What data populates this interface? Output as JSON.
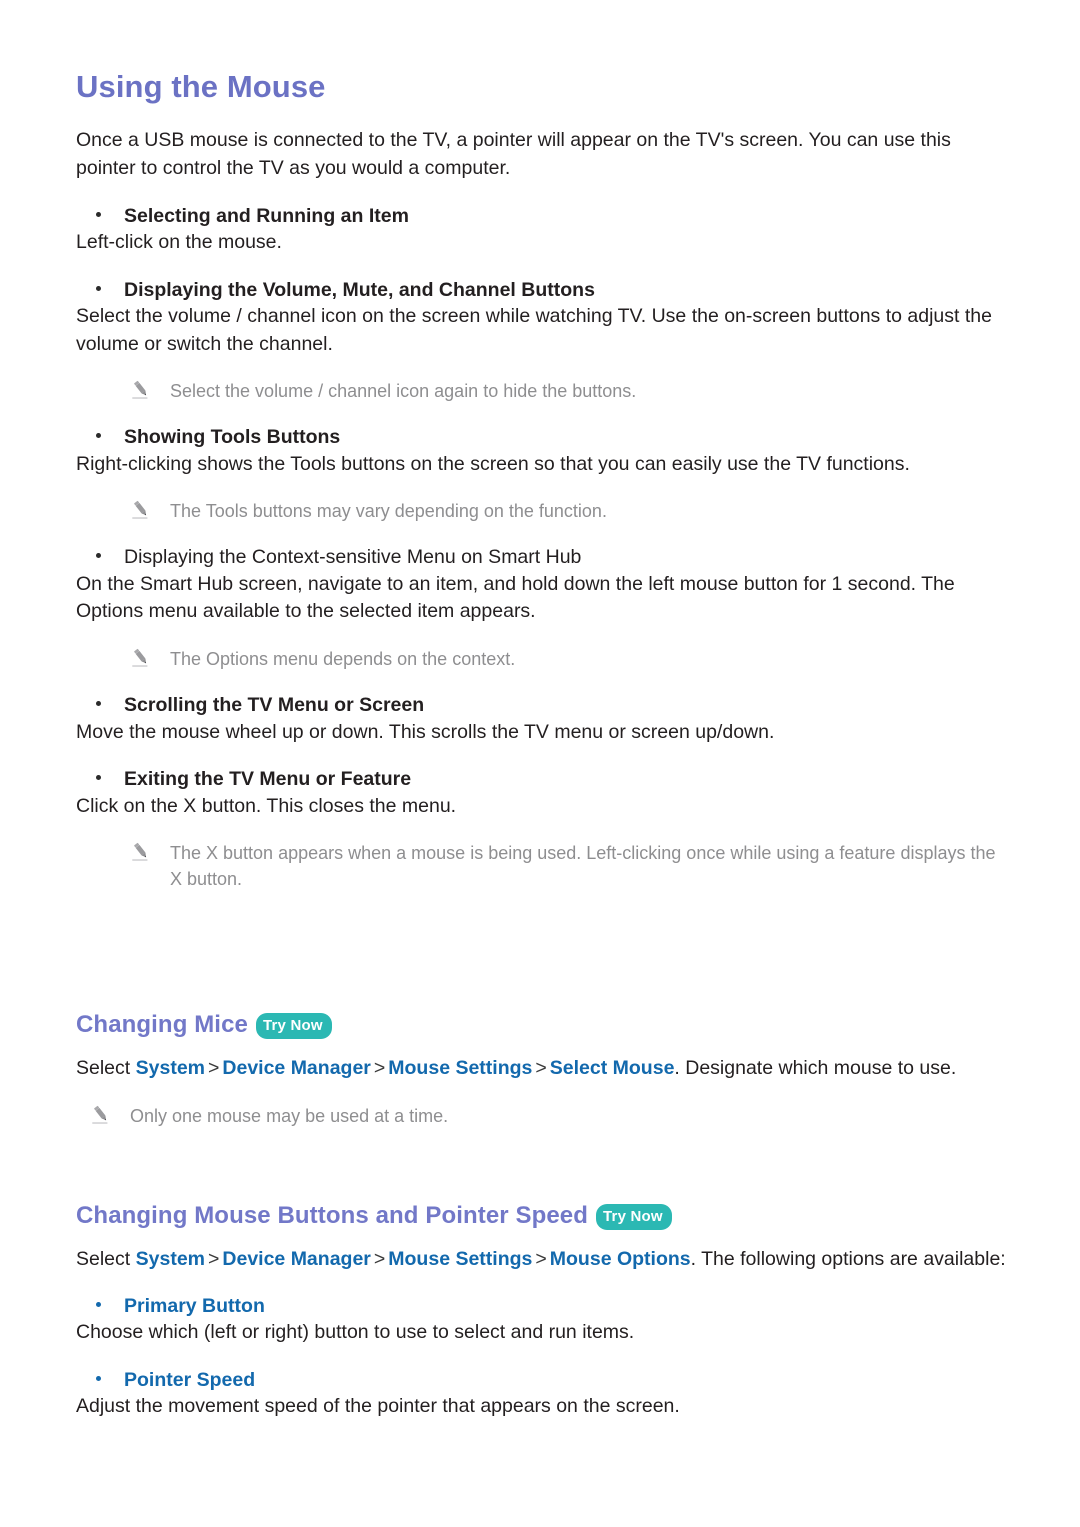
{
  "page": {
    "title": "Using the Mouse",
    "intro": "Once a USB mouse is connected to the TV, a pointer will appear on the TV's screen. You can use this pointer to control the TV as you would a computer."
  },
  "mouse_items": [
    {
      "label": "Selecting and Running an Item",
      "bold": true,
      "body": "Left-click on the mouse.",
      "note": null
    },
    {
      "label": "Displaying the Volume, Mute, and Channel Buttons",
      "bold": true,
      "body": "Select the volume / channel icon on the screen while watching TV. Use the on-screen buttons to adjust the volume or switch the channel.",
      "note": "Select the volume / channel icon again to hide the buttons."
    },
    {
      "label": "Showing Tools Buttons",
      "bold": true,
      "body": "Right-clicking shows the Tools buttons on the screen so that you can easily use the TV functions.",
      "note": "The Tools buttons may vary depending on the function."
    },
    {
      "label": "Displaying the Context-sensitive Menu on Smart Hub",
      "bold": false,
      "body": "On the Smart Hub screen, navigate to an item, and hold down the left mouse button for 1 second. The Options menu available to the selected item appears.",
      "note": "The Options menu depends on the context."
    },
    {
      "label": "Scrolling the TV Menu or Screen",
      "bold": true,
      "body": "Move the mouse wheel up or down. This scrolls the TV menu or screen up/down.",
      "note": null
    },
    {
      "label": "Exiting the TV Menu or Feature",
      "bold": true,
      "body": "Click on the X button. This closes the menu.",
      "note": "The X button appears when a mouse is being used. Left-clicking once while using a feature displays the X button."
    }
  ],
  "changing_mice": {
    "heading": "Changing Mice",
    "try_now": "Try Now",
    "path_prefix": "Select ",
    "path": [
      "System",
      "Device Manager",
      "Mouse Settings",
      "Select Mouse"
    ],
    "separator": ">",
    "path_suffix": ". Designate which mouse to use.",
    "note": "Only one mouse may be used at a time."
  },
  "changing_buttons": {
    "heading": "Changing Mouse Buttons and Pointer Speed",
    "try_now": "Try Now",
    "path_prefix": "Select ",
    "path": [
      "System",
      "Device Manager",
      "Mouse Settings",
      "Mouse Options"
    ],
    "separator": ">",
    "path_suffix": ". The following options are available:",
    "options": [
      {
        "label": "Primary Button",
        "body": "Choose which (left or right) button to use to select and run items."
      },
      {
        "label": "Pointer Speed",
        "body": "Adjust the movement speed of the pointer that appears on the screen."
      }
    ]
  },
  "colors": {
    "heading_purple": "#6b72c4",
    "menu_blue": "#1369ad",
    "try_now_teal": "#2bb8b3",
    "note_gray": "#8e8e90",
    "body_black": "#231f20"
  },
  "icons": {
    "note": "pencil-icon"
  }
}
